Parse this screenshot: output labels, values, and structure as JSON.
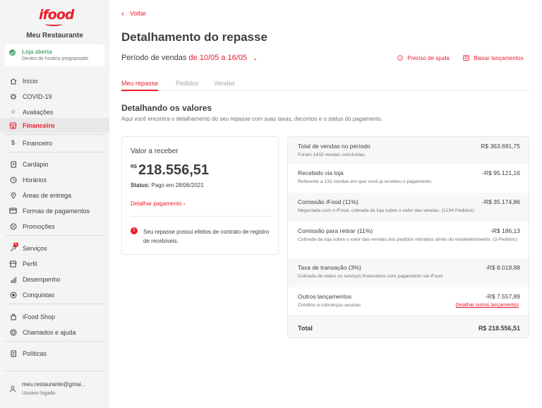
{
  "sidebar": {
    "logo": "ifood",
    "store_name": "Meu Restaurante",
    "status": {
      "title": "Loja aberta",
      "subtitle": "Dentro do horário programado",
      "color": "#50a773"
    },
    "items": [
      {
        "label": "Início",
        "icon": "home-icon"
      },
      {
        "label": "COVID-19",
        "icon": "covid-icon"
      },
      {
        "label": "Avaliações",
        "icon": "star-icon"
      },
      {
        "label": "Financeiro",
        "icon": "store-icon",
        "active": true
      },
      {
        "label": "Financeiro",
        "icon": "dollar-icon"
      },
      {
        "label": "Cardápio",
        "icon": "menu-book-icon"
      },
      {
        "label": "Horários",
        "icon": "clock-icon"
      },
      {
        "label": "Áreas de entrega",
        "icon": "map-pin-icon"
      },
      {
        "label": "Formas de pagamentos",
        "icon": "credit-card-icon"
      },
      {
        "label": "Promoções",
        "icon": "promo-icon"
      },
      {
        "label": "Serviços",
        "icon": "services-icon",
        "badge": "1"
      },
      {
        "label": "Perfil",
        "icon": "profile-store-icon"
      },
      {
        "label": "Desempenho",
        "icon": "chart-icon"
      },
      {
        "label": "Conquistas",
        "icon": "medal-icon"
      },
      {
        "label": "iFood Shop",
        "icon": "bag-icon"
      },
      {
        "label": "Chamados e ajuda",
        "icon": "help-chat-icon"
      },
      {
        "label": "Políticas",
        "icon": "document-icon"
      }
    ],
    "user": {
      "email": "meu.restaurante@gmai...",
      "subtitle": "Usuário logado"
    }
  },
  "header": {
    "back_label": "Voltar",
    "title": "Detalhamento do repasse",
    "period_label": "Período de vendas",
    "period_dates": "de 10/05 a 16/05",
    "help_label": "Preciso de ajuda",
    "download_label": "Baixar lançamentos"
  },
  "tabs": [
    {
      "label": "Meu repasse",
      "active": true
    },
    {
      "label": "Pedidos"
    },
    {
      "label": "Vendas"
    }
  ],
  "section": {
    "title": "Detalhando os valores",
    "subtitle": "Aqui você encontra o detalhamento do seu repasse com suas taxas, decontos e o status do pagamento."
  },
  "summary": {
    "label": "Valor a receber",
    "currency": "R$",
    "amount": "218.556,51",
    "status_label": "Status:",
    "status_value": "Pago em 28/06/2021",
    "link_label": "Detalhar pagamento",
    "warning": "Seu repasse possui efeitos de contrato de registro de recebíveis."
  },
  "breakdown": [
    {
      "label": "Total de vendas no período",
      "value": "R$ 363.691,75",
      "desc": "Foram 1432 vendas concluídas."
    },
    {
      "label": "Recebido via loja",
      "value": "-R$ 95.121,16",
      "desc": "Referente a 132 vendas em que você já recebeu o pagamento."
    },
    {
      "label": "Comissão iFood (11%)",
      "value": "-R$ 35.174,86",
      "desc": "Negociada com o iFood, cobrada da loja sobre o valor das vendas. (1234 Pedidos)"
    },
    {
      "label": "Comissão para retirar (11%)",
      "value": "-R$ 186,13",
      "desc": "Cobrada da loja sobre o valor das vendas dos pedidos retirados direto do estabelecimento. (3 Pedidos)"
    },
    {
      "label": "Taxa de transação (3%)",
      "value": "-R$ 8.019,88",
      "desc": "Cobrada de todos os serviços financeiros com pagamento via iFood."
    },
    {
      "label": "Outros lançamentos",
      "value": "-R$ 7.557,89",
      "desc": "Créditos e cobranças avulsas",
      "link": "Detalhar outros lançamentos"
    },
    {
      "label": "Total",
      "value": "R$ 218.556,51"
    }
  ],
  "colors": {
    "accent": "#ea1d2c",
    "success": "#50a773"
  }
}
